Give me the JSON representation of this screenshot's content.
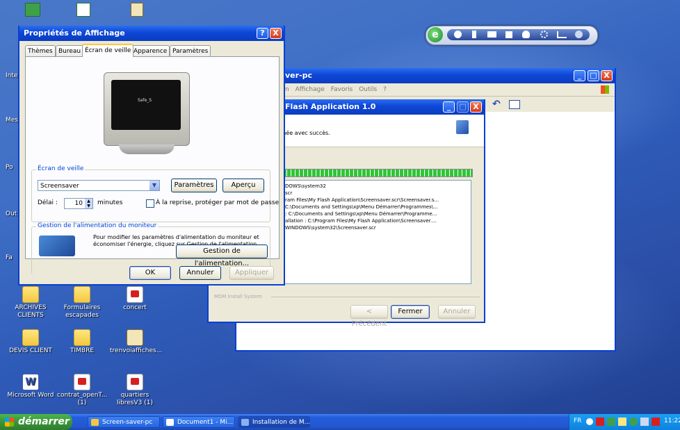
{
  "desktop": {
    "side_labels": [
      "Inte",
      "Mes",
      "Po",
      "Out",
      "Fa"
    ],
    "icons": [
      {
        "label": "ARCHIVES CLIENTS",
        "icon": "folder-icon"
      },
      {
        "label": "Formulaires escapades",
        "icon": "folder-icon"
      },
      {
        "label": "concert",
        "icon": "pdf-file-icon"
      },
      {
        "label": "DEVIS CLIENT",
        "icon": "folder-icon"
      },
      {
        "label": "TIMBRE",
        "icon": "folder-icon"
      },
      {
        "label": "trenvoiaffiches...",
        "icon": "archive-file-icon"
      },
      {
        "label": "Microsoft Word",
        "icon": "word-document-icon"
      },
      {
        "label": "contrat_openT... (1)",
        "icon": "pdf-file-icon"
      },
      {
        "label": "quartiers libresV3 (1)",
        "icon": "pdf-file-icon"
      }
    ]
  },
  "display_properties": {
    "title": "Propriétés de Affichage",
    "tabs": [
      "Thèmes",
      "Bureau",
      "Écran de veille",
      "Apparence",
      "Paramètres"
    ],
    "active_tab": "Écran de veille",
    "preview_text": "Safe_S",
    "screensaver_group": "Écran de veille",
    "screensaver_value": "Screensaver",
    "settings_button": "Paramètres",
    "preview_button": "Aperçu",
    "delay_label": "Délai :",
    "delay_value": "10",
    "minutes_label": "minutes",
    "password_checkbox_label": "À la reprise, protéger par mot de passe",
    "password_checked": false,
    "power_group": "Gestion de l'alimentation du moniteur",
    "power_text": "Pour modifier les paramètres d'alimentation du moniteur et économiser l'énergie, cliquez sur Gestion de l'alimentation.",
    "power_button": "Gestion de l'alimentation...",
    "ok_button": "OK",
    "cancel_button": "Annuler",
    "apply_button": "Appliquer",
    "help_button": "?",
    "close_button": "X"
  },
  "explorer": {
    "title": "ver-pc",
    "menu": [
      "n",
      "Affichage",
      "Favoris",
      "Outils",
      "?"
    ]
  },
  "installer": {
    "title": "Flash Application 1.0",
    "header_text": "inée avec succès.",
    "progress": 1.0,
    "log_lines": [
      "DOWS\\system32",
      "scr",
      "ram Files\\My Flash Application\\Screensaver.scr\\Screensaver.s...",
      "C:\\Documents and Settings\\xp\\Menu Démarrer\\Programmes\\...",
      ": C:\\Documents and Settings\\xp\\Menu Démarrer\\Programme...",
      "allation : C:\\Program Files\\My Flash Application\\Screensaver....",
      "WINDOWS\\system32\\Screensaver.scr"
    ],
    "footer_label": "MDM Install System",
    "back_button": "< Précédent",
    "close_button": "Fermer",
    "cancel_button": "Annuler"
  },
  "taskbar": {
    "start_label": "démarrer",
    "tasks": [
      "Screen-saver-pc",
      "Document1 - Mi...",
      "Installation de M..."
    ],
    "language": "FR",
    "clock": "11:22"
  },
  "colors": {
    "xp_blue": "#0a3fd0",
    "taskbar_blue": "#245edb",
    "start_green": "#3c9a3c",
    "progress_green": "#31c43a"
  }
}
